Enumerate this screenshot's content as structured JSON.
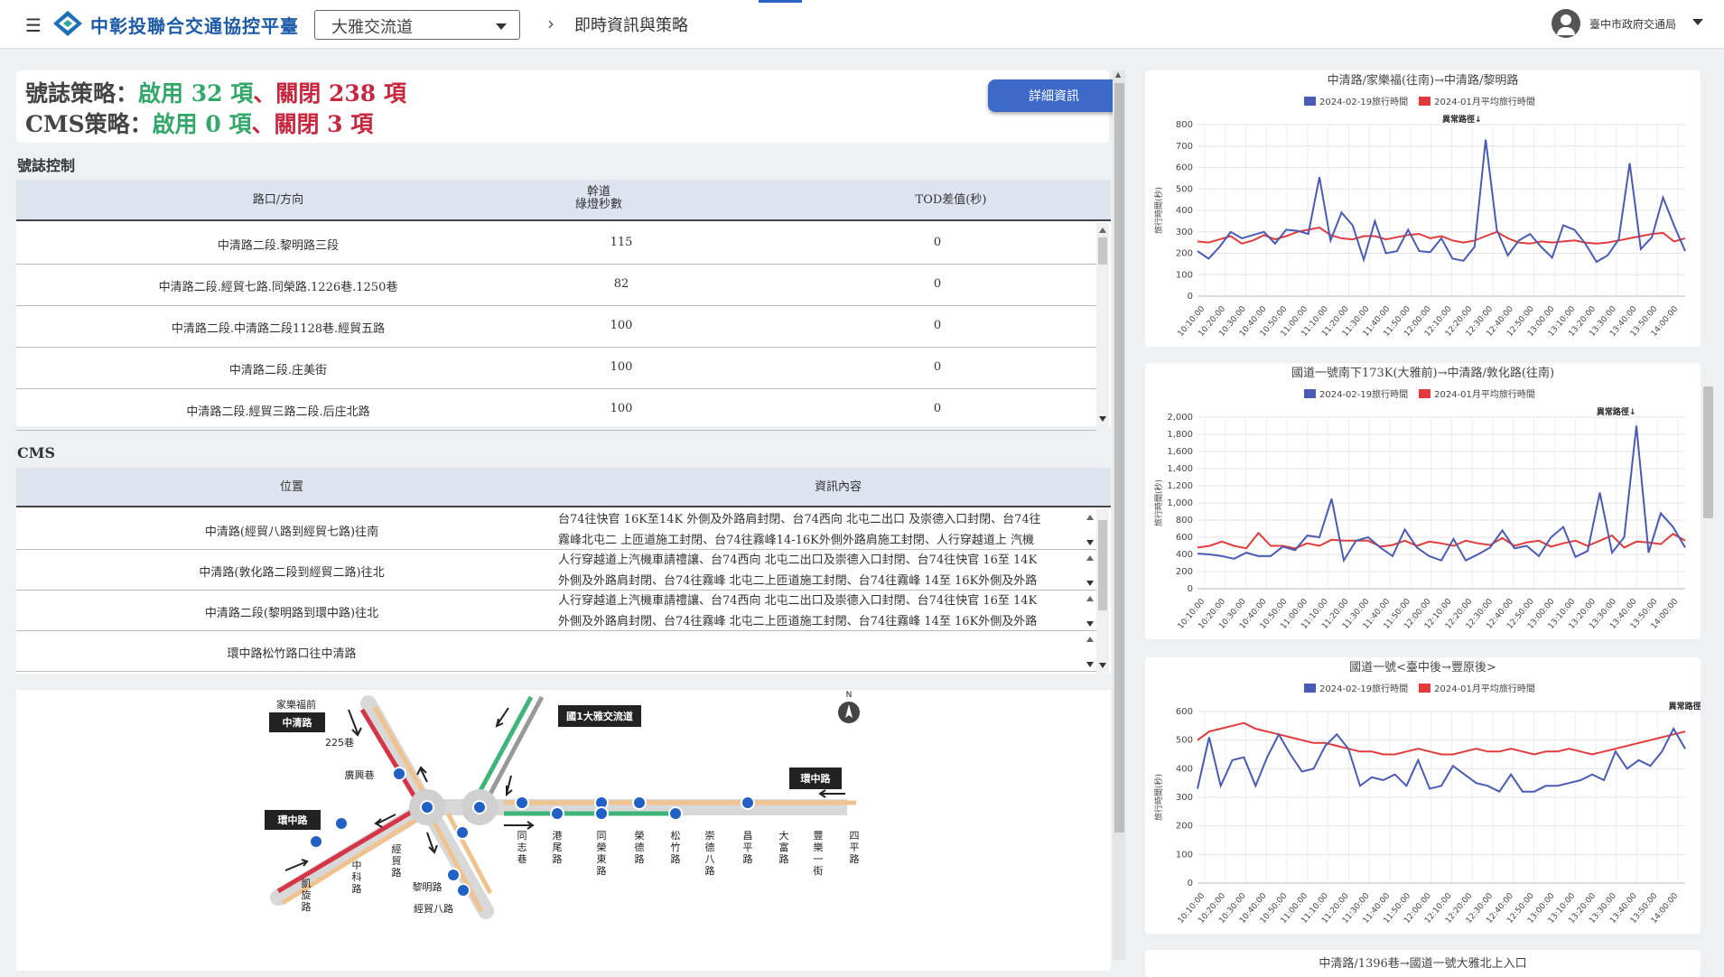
{
  "header": {
    "brand": "中彰投聯合交通協控平臺",
    "interchange": "大雅交流道",
    "breadcrumb": "即時資訊與策略",
    "user": "臺中市政府交通局"
  },
  "summary": {
    "signal_label": "號誌策略：",
    "signal_on": "啟用 32 項",
    "signal_sep": "、",
    "signal_off": "關閉 238 項",
    "cms_label": "CMS策略：",
    "cms_on": "啟用 0 項",
    "cms_sep": "、",
    "cms_off": "關閉 3 項",
    "detail_button": "詳細資訊"
  },
  "signal_table": {
    "title": "號誌控制",
    "headers": {
      "intersection": "路口/方向",
      "green_line1": "幹道",
      "green_line2": "綠燈秒數",
      "tod": "TOD差值(秒)"
    },
    "rows": [
      {
        "name": "中清路二段.黎明路三段",
        "green": "115",
        "tod": "0"
      },
      {
        "name": "中清路二段.經貿七路.同榮路.1226巷.1250巷",
        "green": "82",
        "tod": "0"
      },
      {
        "name": "中清路二段.中清路二段1128巷.經貿五路",
        "green": "100",
        "tod": "0"
      },
      {
        "name": "中清路二段.庄美街",
        "green": "100",
        "tod": "0"
      },
      {
        "name": "中清路二段.經貿三路二段.后庄北路",
        "green": "100",
        "tod": "0"
      }
    ]
  },
  "cms_table": {
    "title": "CMS",
    "headers": {
      "location": "位置",
      "content": "資訊內容"
    },
    "rows": [
      {
        "location": "中清路(經貿八路到經貿七路)往南",
        "line1": "台74往快官 16K至14K 外側及外路肩封閉、台74西向 北屯二出口 及崇德入口封閉、台74往",
        "line2": "霧峰北屯二 上匝道施工封閉、台74往霧峰14-16K外側外路肩施工封閉、人行穿越道上 汽機"
      },
      {
        "location": "中清路(敦化路二段到經貿二路)往北",
        "line1": "人行穿越道上汽機車請禮讓、台74西向 北屯二出口及崇德入口封閉、台74往快官 16至 14K",
        "line2": "外側及外路肩封閉、台74往霧峰 北屯二上匝道施工封閉、台74往霧峰 14至 16K外側及外路"
      },
      {
        "location": "中清路二段(黎明路到環中路)往北",
        "line1": "人行穿越道上汽機車請禮讓、台74西向 北屯二出口及崇德入口封閉、台74往快官 16至 14K",
        "line2": "外側及外路肩封閉、台74往霧峰 北屯二上匝道施工封閉、台74往霧峰 14至 16K外側及外路"
      },
      {
        "location": "環中路松竹路口往中清路",
        "line1": "",
        "line2": ""
      }
    ]
  },
  "map": {
    "labels": {
      "jiale": "家樂福前",
      "zhongqing": "中清路",
      "l225": "225巷",
      "guangxing": "廣興巷",
      "huanzhong_l": "環中路",
      "zhongke": "中科路",
      "jingmao": "經貿路",
      "kaixuan": "凱旋路",
      "liming": "黎明路",
      "jingmao8": "經貿八路",
      "interchange": "國1大雅交流道",
      "north": "N",
      "huanzhong_r": "環中路",
      "tongzhi": "同志巷",
      "gangwei": "港尾路",
      "tongrongdong": "同榮東路",
      "rongde": "榮德路",
      "songzhu": "松竹路",
      "chongde8": "崇德八路",
      "changping": "昌平路",
      "dafu": "大富路",
      "fengle1": "豐樂一街",
      "siping": "四平路"
    }
  },
  "charts": {
    "legend_a": "2024-02-19旅行時間",
    "legend_b": "2024-01月平均旅行時間",
    "ylabel": "旅行時間(秒)",
    "annotation": "異常路徑↓",
    "next_title": "中清路/1396巷→國道一號大雅北上入口"
  },
  "chart_data": [
    {
      "type": "line",
      "title": "中清路/家樂福(往南)→中清路/黎明路",
      "ylabel": "旅行時間(秒)",
      "ylim": [
        0,
        800
      ],
      "yticks": [
        0,
        100,
        200,
        300,
        400,
        500,
        600,
        700,
        800
      ],
      "x": [
        "10:10:00",
        "10:20:00",
        "10:30:00",
        "10:40:00",
        "10:50:00",
        "11:00:00",
        "11:10:00",
        "11:20:00",
        "11:30:00",
        "11:40:00",
        "11:50:00",
        "12:00:00",
        "12:10:00",
        "12:20:00",
        "12:30:00",
        "12:40:00",
        "12:50:00",
        "13:00:00",
        "13:10:00",
        "13:20:00",
        "13:30:00",
        "13:40:00",
        "13:50:00",
        "14:00:00"
      ],
      "annotation": "異常路徑↓",
      "annotation_x": 12.5,
      "series": [
        {
          "name": "2024-02-19旅行時間",
          "color": "#4a5bb5",
          "values": [
            210,
            175,
            230,
            300,
            270,
            285,
            300,
            245,
            310,
            305,
            290,
            555,
            260,
            390,
            330,
            170,
            350,
            200,
            210,
            310,
            210,
            205,
            270,
            175,
            165,
            230,
            730,
            310,
            190,
            260,
            290,
            230,
            180,
            330,
            310,
            245,
            160,
            190,
            265,
            620,
            220,
            275,
            460,
            330,
            210
          ]
        },
        {
          "name": "2024-01月平均旅行時間",
          "color": "#e23b3b",
          "values": [
            255,
            250,
            265,
            280,
            245,
            260,
            285,
            265,
            280,
            300,
            310,
            320,
            285,
            270,
            265,
            280,
            280,
            265,
            275,
            285,
            290,
            270,
            280,
            260,
            250,
            260,
            280,
            300,
            270,
            250,
            245,
            255,
            250,
            255,
            260,
            250,
            245,
            250,
            260,
            270,
            280,
            290,
            295,
            255,
            270
          ]
        }
      ]
    },
    {
      "type": "line",
      "title": "國道一號南下173K(大雅前)→中清路/敦化路(往南)",
      "ylabel": "旅行時間(秒)",
      "ylim": [
        0,
        2000
      ],
      "yticks": [
        0,
        200,
        400,
        600,
        800,
        1000,
        1200,
        1400,
        1600,
        1800,
        2000
      ],
      "x": [
        "10:10:00",
        "10:20:00",
        "10:30:00",
        "10:40:00",
        "10:50:00",
        "11:00:00",
        "11:10:00",
        "11:20:00",
        "11:30:00",
        "11:40:00",
        "11:50:00",
        "12:00:00",
        "12:10:00",
        "12:20:00",
        "12:30:00",
        "12:40:00",
        "12:50:00",
        "13:00:00",
        "13:10:00",
        "13:20:00",
        "13:30:00",
        "13:40:00",
        "13:50:00",
        "14:00:00"
      ],
      "annotation": "異常路徑↓",
      "annotation_x": 20,
      "series": [
        {
          "name": "2024-02-19旅行時間",
          "color": "#4a5bb5",
          "values": [
            410,
            400,
            380,
            350,
            420,
            380,
            380,
            490,
            450,
            620,
            600,
            1050,
            330,
            560,
            600,
            480,
            380,
            690,
            480,
            380,
            330,
            580,
            330,
            400,
            480,
            680,
            470,
            500,
            380,
            600,
            720,
            370,
            440,
            1120,
            420,
            600,
            1900,
            420,
            880,
            720,
            480
          ]
        },
        {
          "name": "2024-01月平均旅行時間",
          "color": "#e23b3b",
          "values": [
            480,
            500,
            550,
            500,
            470,
            650,
            500,
            500,
            470,
            530,
            500,
            570,
            560,
            560,
            560,
            490,
            510,
            560,
            500,
            550,
            530,
            500,
            560,
            530,
            510,
            590,
            500,
            540,
            560,
            490,
            530,
            560,
            500,
            560,
            620,
            480,
            550,
            540,
            520,
            640,
            560
          ]
        }
      ]
    },
    {
      "type": "line",
      "title": "國道一號<臺中後→豐原後>",
      "ylabel": "旅行時間(秒)",
      "ylim": [
        0,
        600
      ],
      "yticks": [
        0,
        100,
        200,
        300,
        400,
        500,
        600
      ],
      "x": [
        "10:10:00",
        "10:20:00",
        "10:30:00",
        "10:40:00",
        "10:50:00",
        "11:00:00",
        "11:10:00",
        "11:20:00",
        "11:30:00",
        "11:40:00",
        "11:50:00",
        "12:00:00",
        "12:10:00",
        "12:20:00",
        "12:30:00",
        "12:40:00",
        "12:50:00",
        "13:00:00",
        "13:10:00",
        "13:20:00",
        "13:30:00",
        "13:40:00",
        "13:50:00",
        "14:00:00"
      ],
      "annotation": "異常路徑↓",
      "annotation_x": 23.5,
      "series": [
        {
          "name": "2024-02-19旅行時間",
          "color": "#4a5bb5",
          "values": [
            330,
            510,
            340,
            430,
            440,
            340,
            440,
            520,
            450,
            390,
            400,
            480,
            520,
            470,
            340,
            370,
            360,
            380,
            340,
            430,
            330,
            340,
            410,
            380,
            350,
            340,
            320,
            380,
            320,
            320,
            340,
            340,
            350,
            360,
            380,
            360,
            460,
            400,
            430,
            410,
            460,
            540,
            470
          ]
        },
        {
          "name": "2024-01月平均旅行時間",
          "color": "#e23b3b",
          "values": [
            500,
            530,
            540,
            550,
            560,
            540,
            530,
            520,
            510,
            500,
            490,
            490,
            480,
            470,
            460,
            460,
            450,
            450,
            460,
            470,
            460,
            450,
            450,
            460,
            470,
            460,
            460,
            470,
            460,
            450,
            460,
            460,
            470,
            460,
            450,
            460,
            470,
            480,
            490,
            500,
            510,
            520,
            530
          ]
        }
      ]
    }
  ]
}
